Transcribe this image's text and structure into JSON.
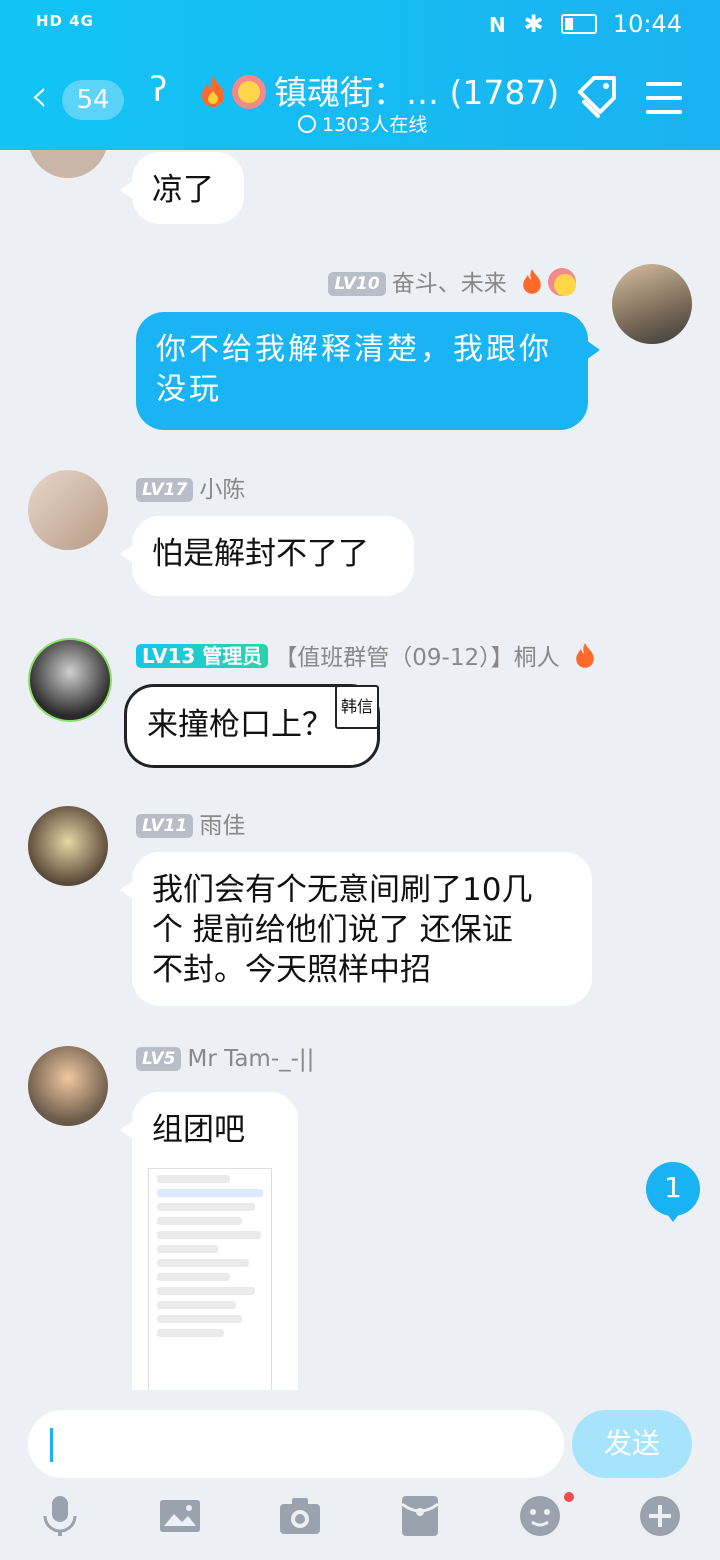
{
  "status_bar": {
    "left": "HD 4G",
    "time": "10:44"
  },
  "header": {
    "back_count": "54",
    "title": "镇魂街：… (1787)",
    "online": "1303人在线"
  },
  "messages": [
    {
      "text": "凉了"
    },
    {
      "level": "LV10",
      "name": "奋斗、未来",
      "text_line1": "你不给我解释清楚，我跟你",
      "text_line2": "没玩"
    },
    {
      "level": "LV17",
      "name": "小陈",
      "text": "怕是解封不了了"
    },
    {
      "level": "LV13",
      "role": "管理员",
      "name": "【值班群管（09-12）】桐人",
      "tag": "韩信",
      "text": "来撞枪口上？"
    },
    {
      "level": "LV11",
      "name": "雨佳",
      "text_line1": "我们会有个无意间刷了10几",
      "text_line2": "个 提前给他们说了 还保证",
      "text_line3": "不封。今天照样中招"
    },
    {
      "level": "LV5",
      "name": "Mr Tam-_-||",
      "text": "组团吧"
    }
  ],
  "unread_badge": "1",
  "composer": {
    "send_label": "发送"
  },
  "toolbar": [
    "mic-icon",
    "image-icon",
    "camera-icon",
    "red-packet-icon",
    "emoji-icon",
    "plus-icon"
  ],
  "colors": {
    "brand": "#1ab4f4",
    "background": "#eceff4"
  }
}
